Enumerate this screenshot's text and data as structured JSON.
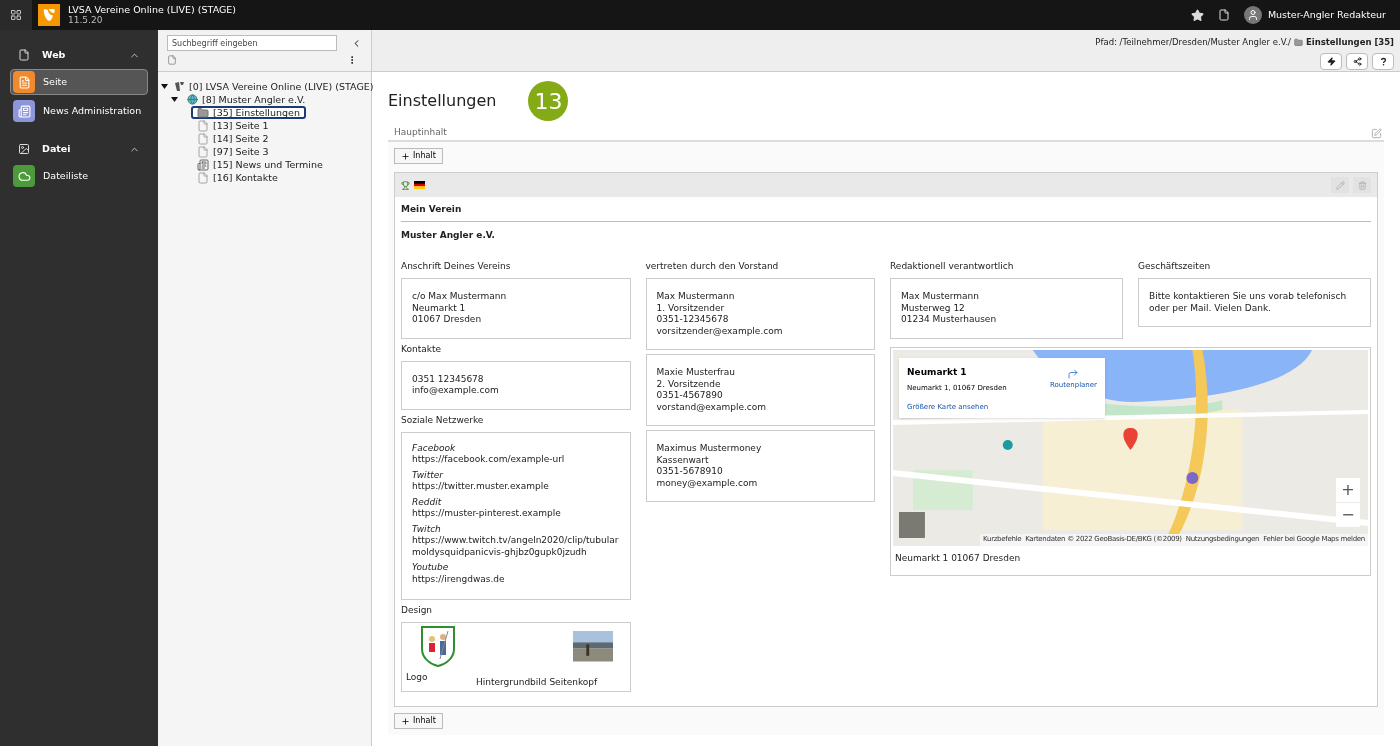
{
  "topbar": {
    "site_title": "LVSA Vereine Online (LIVE) (STAGE)",
    "version": "11.5.20",
    "user": "Muster-Angler Redakteur"
  },
  "module_menu": [
    {
      "label": "Web",
      "expanded": true,
      "items": [
        {
          "label": "Seite",
          "kind": "page",
          "color": "#f08a2c",
          "selected": true
        },
        {
          "label": "News Administration",
          "kind": "news",
          "color": "#8c96d8",
          "selected": false
        }
      ]
    },
    {
      "label": "Datei",
      "expanded": true,
      "items": [
        {
          "label": "Dateiliste",
          "kind": "files",
          "color": "#4c9a3c",
          "selected": false
        }
      ]
    }
  ],
  "page_tree": {
    "search": {
      "placeholder": "Suchbegriff eingeben"
    },
    "nodes": [
      {
        "label": "[0] LVSA Vereine Online (LIVE) (STAGE)",
        "kind": "root",
        "expanded": true,
        "selected": false,
        "children": [
          {
            "label": "[8] Muster Angler e.V.",
            "kind": "globe",
            "expanded": true,
            "selected": false,
            "children": [
              {
                "label": "[35] Einstellungen",
                "kind": "folder",
                "selected": true
              },
              {
                "label": "[13] Seite 1",
                "kind": "page",
                "selected": false
              },
              {
                "label": "[14] Seite 2",
                "kind": "page",
                "selected": false
              },
              {
                "label": "[97] Seite 3",
                "kind": "page",
                "selected": false
              },
              {
                "label": "[15] News und Termine",
                "kind": "news",
                "selected": false
              },
              {
                "label": "[16] Kontakte",
                "kind": "page",
                "selected": false
              }
            ]
          }
        ]
      }
    ]
  },
  "docheader": {
    "path_prefix": "Pfad: /Teilnehmer/Dresden/Muster Angler e.V./",
    "path_page": "Einstellungen [35]"
  },
  "page": {
    "title": "Einstellungen",
    "badge": "13",
    "column_label": "Hauptinhalt",
    "add_buttons": [
      "Inhalt",
      "Inhalt"
    ],
    "element": {
      "heading": "Mein Verein",
      "name": "Muster Angler e.V.",
      "columns": [
        {
          "sections": [
            {
              "label": "Anschrift Deines Vereins",
              "boxes": [
                {
                  "kind": "lines",
                  "lines": [
                    "c/o Max Mustermann",
                    "Neumarkt 1",
                    "01067 Dresden"
                  ]
                }
              ]
            },
            {
              "label": "Kontakte",
              "boxes": [
                {
                  "kind": "lines",
                  "lines": [
                    "0351 12345678",
                    "info@example.com"
                  ]
                }
              ]
            },
            {
              "label": "Soziale Netzwerke",
              "boxes": [
                {
                  "kind": "social",
                  "entries": [
                    {
                      "network": "Facebook",
                      "url": "https://facebook.com/example-url"
                    },
                    {
                      "network": "Twitter",
                      "url": "https://twitter.muster.example"
                    },
                    {
                      "network": "Reddit",
                      "url": "https://muster-pinterest.example"
                    },
                    {
                      "network": "Twitch",
                      "url": "https://www.twitch.tv/angeln2020/clip/tubularmoldysquidpanicvis-ghjbz0gupk0jzudh"
                    },
                    {
                      "network": "Youtube",
                      "url": "https://irengdwas.de"
                    }
                  ]
                }
              ]
            },
            {
              "label": "Design",
              "boxes": [
                {
                  "kind": "design",
                  "images": [
                    {
                      "kind": "logo",
                      "label": "Logo"
                    },
                    {
                      "label": "Hintergrundbild Seitenkopf"
                    }
                  ]
                }
              ]
            }
          ]
        },
        {
          "sections": [
            {
              "label": "vertreten durch den Vorstand",
              "boxes": [
                {
                  "kind": "lines",
                  "lines": [
                    "Max Mustermann",
                    "1. Vorsitzender",
                    "0351-12345678",
                    "vorsitzender@example.com"
                  ]
                },
                {
                  "kind": "lines",
                  "lines": [
                    "Maxie Musterfrau",
                    "2. Vorsitzende",
                    "0351-4567890",
                    "vorstand@example.com"
                  ]
                },
                {
                  "kind": "lines",
                  "lines": [
                    "Maximus Mustermoney",
                    "Kassenwart",
                    "0351-5678910",
                    "money@example.com"
                  ]
                }
              ]
            }
          ]
        },
        {
          "sections": [
            {
              "label": "Redaktionell verantwortlich",
              "boxes": [
                {
                  "kind": "lines",
                  "lines": [
                    "Max Mustermann",
                    "Musterweg 12",
                    "01234 Musterhausen"
                  ]
                }
              ]
            }
          ]
        },
        {
          "sections": [
            {
              "label": "Geschäftszeiten",
              "boxes": [
                {
                  "kind": "lines",
                  "lines": [
                    "Bitte kontaktieren Sie uns vorab telefonisch oder per Mail. Vielen Dank."
                  ]
                }
              ]
            }
          ]
        }
      ],
      "map": {
        "popup_title": "Neumarkt 1",
        "popup_address": "Neumarkt 1, 01067 Dresden",
        "route": "Routenplaner",
        "larger": "Größere Karte ansehen",
        "zoom_in": "+",
        "zoom_out": "−",
        "footer": [
          "Kurzbefehle",
          "Kartendaten © 2022 GeoBasis-DE/BKG (©2009)",
          "Nutzungsbedingungen",
          "Fehler bei Google Maps melden"
        ],
        "caption": "Neumarkt 1 01067 Dresden"
      }
    }
  }
}
